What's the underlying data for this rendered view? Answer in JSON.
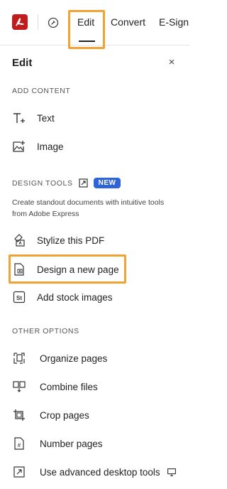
{
  "toolbar": {
    "tabs": [
      {
        "label": "Edit",
        "active": true
      },
      {
        "label": "Convert",
        "active": false
      },
      {
        "label": "E-Sign",
        "active": false
      }
    ]
  },
  "panel": {
    "title": "Edit",
    "close_symbol": "×"
  },
  "add_content": {
    "header": "ADD CONTENT",
    "items": [
      {
        "label": "Text",
        "icon": "add-text-icon"
      },
      {
        "label": "Image",
        "icon": "add-image-icon"
      }
    ]
  },
  "design_tools": {
    "header": "DESIGN TOOLS",
    "badge": "NEW",
    "description": "Create standout documents with intuitive tools from Adobe Express",
    "items": [
      {
        "label": "Stylize this PDF",
        "icon": "stylize-icon"
      },
      {
        "label": "Design a new page",
        "icon": "design-page-icon",
        "highlighted": true
      },
      {
        "label": "Add stock images",
        "icon": "stock-images-icon"
      }
    ]
  },
  "other_options": {
    "header": "OTHER OPTIONS",
    "items": [
      {
        "label": "Organize pages",
        "icon": "organize-pages-icon"
      },
      {
        "label": "Combine files",
        "icon": "combine-files-icon"
      },
      {
        "label": "Crop pages",
        "icon": "crop-icon"
      },
      {
        "label": "Number pages",
        "icon": "number-pages-icon"
      },
      {
        "label": "Use advanced desktop tools",
        "icon": "desktop-tools-icon"
      }
    ]
  },
  "colors": {
    "brand_red": "#c01c1c",
    "new_badge": "#2f63d8",
    "highlight": "#f2a233"
  }
}
